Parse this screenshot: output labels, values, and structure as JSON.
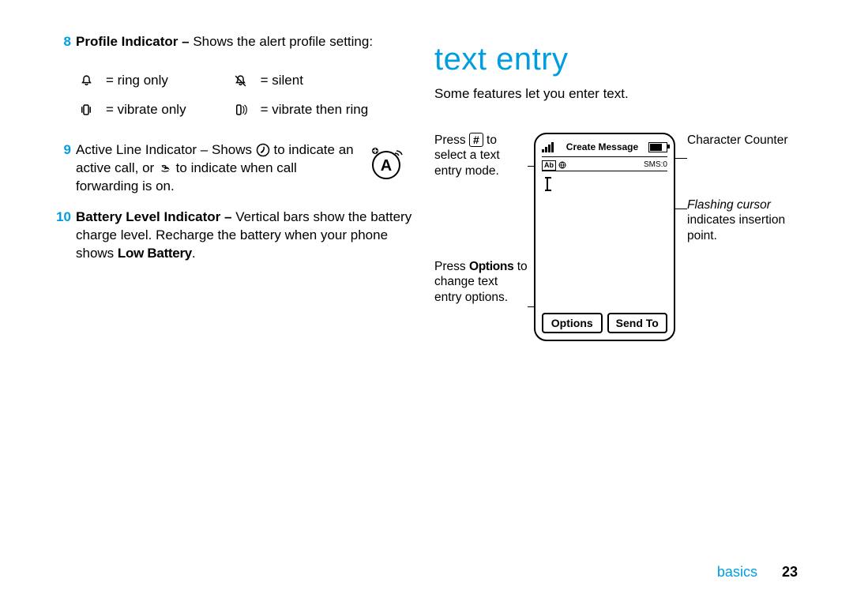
{
  "left": {
    "item8": {
      "num": "8",
      "label": "Profile Indicator –",
      "desc": " Shows the alert profile setting:",
      "profiles": {
        "ring_only": "= ring only",
        "silent": "= silent",
        "vibrate_only": "= vibrate only",
        "vibrate_then_ring": "= vibrate then ring"
      }
    },
    "item9": {
      "num": "9",
      "label": "Active Line Indicator –",
      "desc_a": " Shows ",
      "desc_b": " to indicate an active call, or ",
      "desc_c": " to indicate when call forwarding is on."
    },
    "item10": {
      "num": "10",
      "label": "Battery Level Indicator –",
      "desc_a": " Vertical bars show the battery charge level. Recharge the battery when your phone shows ",
      "low_battery": "Low Battery",
      "desc_b": "."
    }
  },
  "right": {
    "heading": "text entry",
    "intro": "Some features let you enter text.",
    "callout_left_top_a": "Press ",
    "callout_left_top_key": "#",
    "callout_left_top_b": " to select a text entry mode.",
    "callout_left_bottom_a": "Press ",
    "callout_left_bottom_bold": "Options",
    "callout_left_bottom_b": " to change text entry options.",
    "callout_right_top": "Character Counter",
    "callout_right_bottom_italic": "Flashing cursor",
    "callout_right_bottom_rest": " indicates insertion point.",
    "phone": {
      "title": "Create Message",
      "ab": "Ab",
      "sms": "SMS:0",
      "softkey_left": "Options",
      "softkey_right": "Send To"
    }
  },
  "footer": {
    "section": "basics",
    "page": "23"
  }
}
